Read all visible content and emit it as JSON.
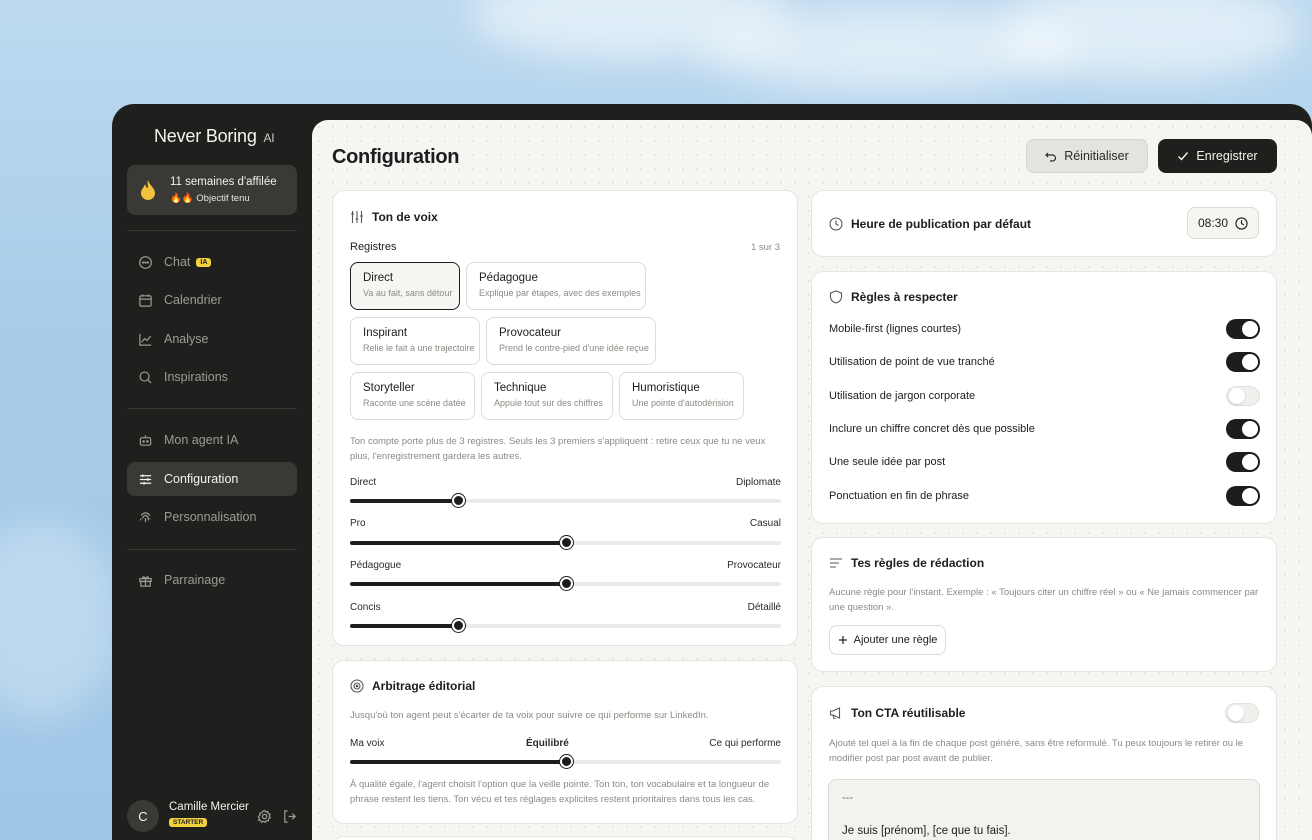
{
  "brand": {
    "name": "Never Boring",
    "suffix": "AI"
  },
  "streak": {
    "title": "11 semaines d'affilée",
    "subtitle": "🔥🔥 Objectif tenu"
  },
  "nav": {
    "chat": "Chat",
    "chat_badge": "IA",
    "calendar": "Calendrier",
    "analysis": "Analyse",
    "inspirations": "Inspirations",
    "agent": "Mon agent IA",
    "config": "Configuration",
    "personalisation": "Personnalisation",
    "referral": "Parrainage"
  },
  "profile": {
    "initial": "C",
    "name": "Camille Mercier",
    "plan": "STARTER"
  },
  "page": {
    "title": "Configuration"
  },
  "actions": {
    "reset": "Réinitialiser",
    "save": "Enregistrer"
  },
  "tone": {
    "title": "Ton de voix",
    "registers_label": "Registres",
    "registers_count": "1 sur 3",
    "chips": [
      {
        "name": "Direct",
        "desc": "Va au fait, sans détour",
        "selected": true
      },
      {
        "name": "Pédagogue",
        "desc": "Explique par étapes, avec des exemples"
      },
      {
        "name": "Inspirant",
        "desc": "Relie le fait à une trajectoire"
      },
      {
        "name": "Provocateur",
        "desc": "Prend le contre-pied d'une idée reçue"
      },
      {
        "name": "Storyteller",
        "desc": "Raconte une scène datée"
      },
      {
        "name": "Technique",
        "desc": "Appuie tout sur des chiffres"
      },
      {
        "name": "Humoristique",
        "desc": "Une pointe d'autodérision"
      }
    ],
    "note_line1": "Ton compte porte plus de 3 registres. Seuls les 3 premiers s'appliquent : retire ceux que tu ne veux",
    "note_line2": "plus, l'enregistrement gardera les autres.",
    "sliders": [
      {
        "left": "Direct",
        "right": "Diplomate",
        "value": 0.25
      },
      {
        "left": "Pro",
        "right": "Casual",
        "value": 0.5
      },
      {
        "left": "Pédagogue",
        "right": "Provocateur",
        "value": 0.5
      },
      {
        "left": "Concis",
        "right": "Détaillé",
        "value": 0.25
      }
    ]
  },
  "arbitration": {
    "title": "Arbitrage éditorial",
    "desc": "Jusqu'où ton agent peut s'écarter de ta voix pour suivre ce qui performe sur LinkedIn.",
    "left": "Ma voix",
    "center": "Équilibré",
    "right": "Ce qui performe",
    "value": 0.5,
    "note_line1": "À qualité égale, l'agent choisit l'option que la veille pointe. Ton ton, ton vocabulaire et ta longueur de",
    "note_line2": "phrase restent les tiens. Ton vécu et tes réglages explicites restent prioritaires dans tous les cas."
  },
  "publish": {
    "title": "Heure de publication par défaut",
    "time": "08:30"
  },
  "rules": {
    "title": "Règles à respecter",
    "items": [
      {
        "label": "Mobile-first (lignes courtes)",
        "on": true
      },
      {
        "label": "Utilisation de point de vue tranché",
        "on": true
      },
      {
        "label": "Utilisation de jargon corporate",
        "on": false
      },
      {
        "label": "Inclure un chiffre concret dès que possible",
        "on": true
      },
      {
        "label": "Une seule idée par post",
        "on": true
      },
      {
        "label": "Ponctuation en fin de phrase",
        "on": true
      }
    ]
  },
  "writing_rules": {
    "title": "Tes règles de rédaction",
    "empty_line1": "Aucune règle pour l'instant. Exemple : « Toujours citer un chiffre réel » ou « Ne jamais commencer par",
    "empty_line2": "une question ».",
    "add": "Ajouter une règle"
  },
  "cta": {
    "title": "Ton CTA réutilisable",
    "enabled": false,
    "desc_line1": "Ajouté tel quel à la fin de chaque post généré, sans être reformulé. Tu peux toujours le retirer ou le",
    "desc_line2": "modifier post par post avant de publier.",
    "line1": "---",
    "line2": "Je suis [prénom], [ce que tu fais]."
  },
  "colors": {
    "accent": "#1d1d1f",
    "badge": "#f2d23c",
    "sidebar": "#1f1f1d"
  }
}
